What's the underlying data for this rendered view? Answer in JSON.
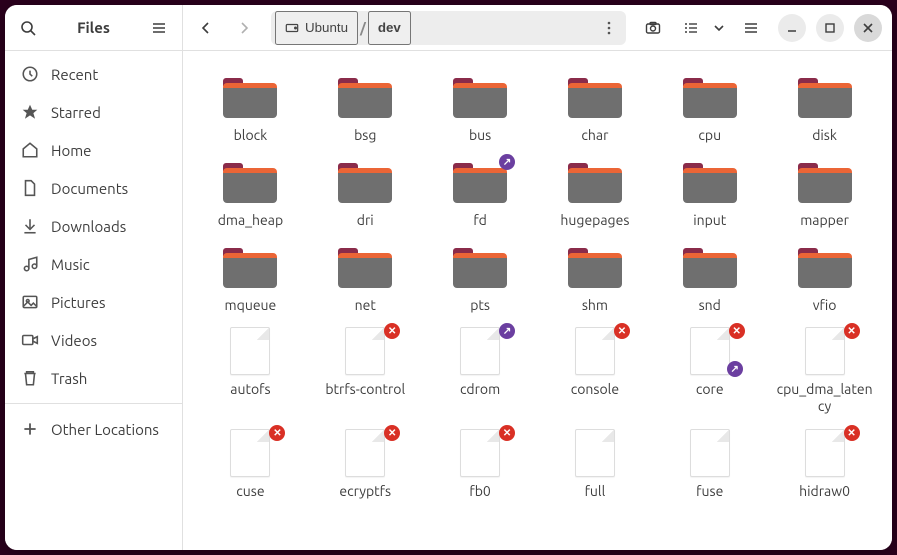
{
  "app_title": "Files",
  "path": {
    "root_label": "Ubuntu",
    "current": "dev"
  },
  "sidebar": {
    "items": [
      {
        "label": "Recent",
        "icon": "clock",
        "key": "recent"
      },
      {
        "label": "Starred",
        "icon": "star",
        "key": "starred"
      },
      {
        "label": "Home",
        "icon": "home",
        "key": "home"
      },
      {
        "label": "Documents",
        "icon": "document",
        "key": "documents"
      },
      {
        "label": "Downloads",
        "icon": "download",
        "key": "downloads"
      },
      {
        "label": "Music",
        "icon": "music",
        "key": "music"
      },
      {
        "label": "Pictures",
        "icon": "picture",
        "key": "pictures"
      },
      {
        "label": "Videos",
        "icon": "video",
        "key": "videos"
      },
      {
        "label": "Trash",
        "icon": "trash",
        "key": "trash"
      }
    ],
    "other_label": "Other Locations"
  },
  "items": [
    {
      "name": "block",
      "type": "folder"
    },
    {
      "name": "bsg",
      "type": "folder"
    },
    {
      "name": "bus",
      "type": "folder"
    },
    {
      "name": "char",
      "type": "folder"
    },
    {
      "name": "cpu",
      "type": "folder"
    },
    {
      "name": "disk",
      "type": "folder"
    },
    {
      "name": "dma_heap",
      "type": "folder"
    },
    {
      "name": "dri",
      "type": "folder"
    },
    {
      "name": "fd",
      "type": "folder",
      "emblems": [
        "link-tr"
      ]
    },
    {
      "name": "hugepages",
      "type": "folder"
    },
    {
      "name": "input",
      "type": "folder"
    },
    {
      "name": "mapper",
      "type": "folder"
    },
    {
      "name": "mqueue",
      "type": "folder"
    },
    {
      "name": "net",
      "type": "folder"
    },
    {
      "name": "pts",
      "type": "folder"
    },
    {
      "name": "shm",
      "type": "folder"
    },
    {
      "name": "snd",
      "type": "folder"
    },
    {
      "name": "vfio",
      "type": "folder"
    },
    {
      "name": "autofs",
      "type": "file"
    },
    {
      "name": "btrfs-control",
      "type": "file",
      "emblems": [
        "error-tr"
      ]
    },
    {
      "name": "cdrom",
      "type": "file",
      "emblems": [
        "link-tr"
      ]
    },
    {
      "name": "console",
      "type": "file",
      "emblems": [
        "error-tr"
      ]
    },
    {
      "name": "core",
      "type": "file",
      "emblems": [
        "error-tr",
        "link-br"
      ]
    },
    {
      "name": "cpu_dma_latency",
      "type": "file",
      "emblems": [
        "error-tr"
      ]
    },
    {
      "name": "cuse",
      "type": "file",
      "emblems": [
        "error-tr"
      ]
    },
    {
      "name": "ecryptfs",
      "type": "file",
      "emblems": [
        "error-tr"
      ]
    },
    {
      "name": "fb0",
      "type": "file",
      "emblems": [
        "error-tr"
      ]
    },
    {
      "name": "full",
      "type": "file"
    },
    {
      "name": "fuse",
      "type": "file"
    },
    {
      "name": "hidraw0",
      "type": "file",
      "emblems": [
        "error-tr"
      ]
    }
  ]
}
